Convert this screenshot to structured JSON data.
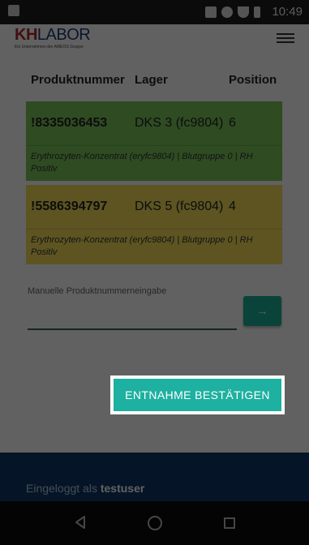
{
  "status_bar": {
    "time": "10:49"
  },
  "app": {
    "logo_main": "KH",
    "logo_lab": "LABOR",
    "logo_sub": "Ein Unternehmen der AMEOS Gruppe"
  },
  "table": {
    "headers": [
      "Produktnummer",
      "Lager",
      "Position"
    ],
    "rows": [
      {
        "id": "!8335036453",
        "lager": "DKS 3 (fc9804)",
        "position": "6",
        "details": "Erythrozyten-Konzentrat (eryfc9804) | Blutgruppe 0 | RH Positiv",
        "color": "#7cc45a"
      },
      {
        "id": "!5586394797",
        "lager": "DKS 5 (fc9804)",
        "position": "4",
        "details": "Erythrozyten-Konzentrat (eryfc9804) | Blutgruppe 0 | RH Positiv",
        "color": "#f3dd5a"
      }
    ]
  },
  "manual_input": {
    "label": "Manuelle Produktnummerneingabe",
    "submit_glyph": "→"
  },
  "confirm_button": {
    "label": "ENTNAHME BESTÄTIGEN"
  },
  "footer": {
    "prefix": "Eingeloggt als",
    "user": "testuser"
  },
  "colors": {
    "accent": "#1eb0a0",
    "footer": "#0e3866",
    "row_green": "#7cc45a",
    "row_yellow": "#f3dd5a"
  }
}
